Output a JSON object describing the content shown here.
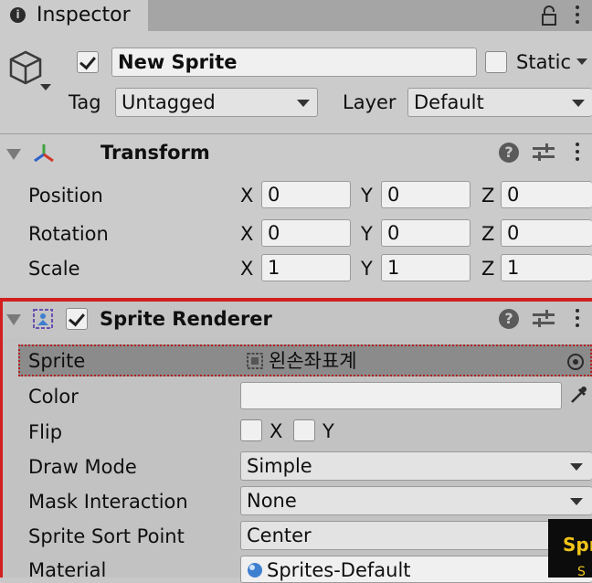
{
  "tab": {
    "label": "Inspector"
  },
  "object": {
    "name": "New Sprite",
    "active": true,
    "static_label": "Static",
    "static": false,
    "tag_label": "Tag",
    "tag_value": "Untagged",
    "layer_label": "Layer",
    "layer_value": "Default"
  },
  "transform": {
    "title": "Transform",
    "rows": [
      {
        "label": "Position",
        "x": "0",
        "y": "0",
        "z": "0"
      },
      {
        "label": "Rotation",
        "x": "0",
        "y": "0",
        "z": "0"
      },
      {
        "label": "Scale",
        "x": "1",
        "y": "1",
        "z": "1"
      }
    ],
    "axes": {
      "x": "X",
      "y": "Y",
      "z": "Z"
    }
  },
  "sprite_renderer": {
    "title": "Sprite Renderer",
    "enabled": true,
    "sprite_label": "Sprite",
    "sprite_value": "왼손좌표계",
    "color_label": "Color",
    "color_value": "#f0f0f0",
    "flip_label": "Flip",
    "flip_x": "X",
    "flip_y": "Y",
    "draw_mode_label": "Draw Mode",
    "draw_mode_value": "Simple",
    "mask_label": "Mask Interaction",
    "mask_value": "None",
    "sort_point_label": "Sprite Sort Point",
    "sort_point_value": "Center",
    "material_label": "Material",
    "material_value": "Sprites-Default"
  },
  "tooltip": {
    "text": "Spr",
    "text2": "S"
  },
  "colors": {
    "highlight": "#d21f1f",
    "selected_row": "#8b8b8b",
    "panel": "#cbcbcb"
  }
}
